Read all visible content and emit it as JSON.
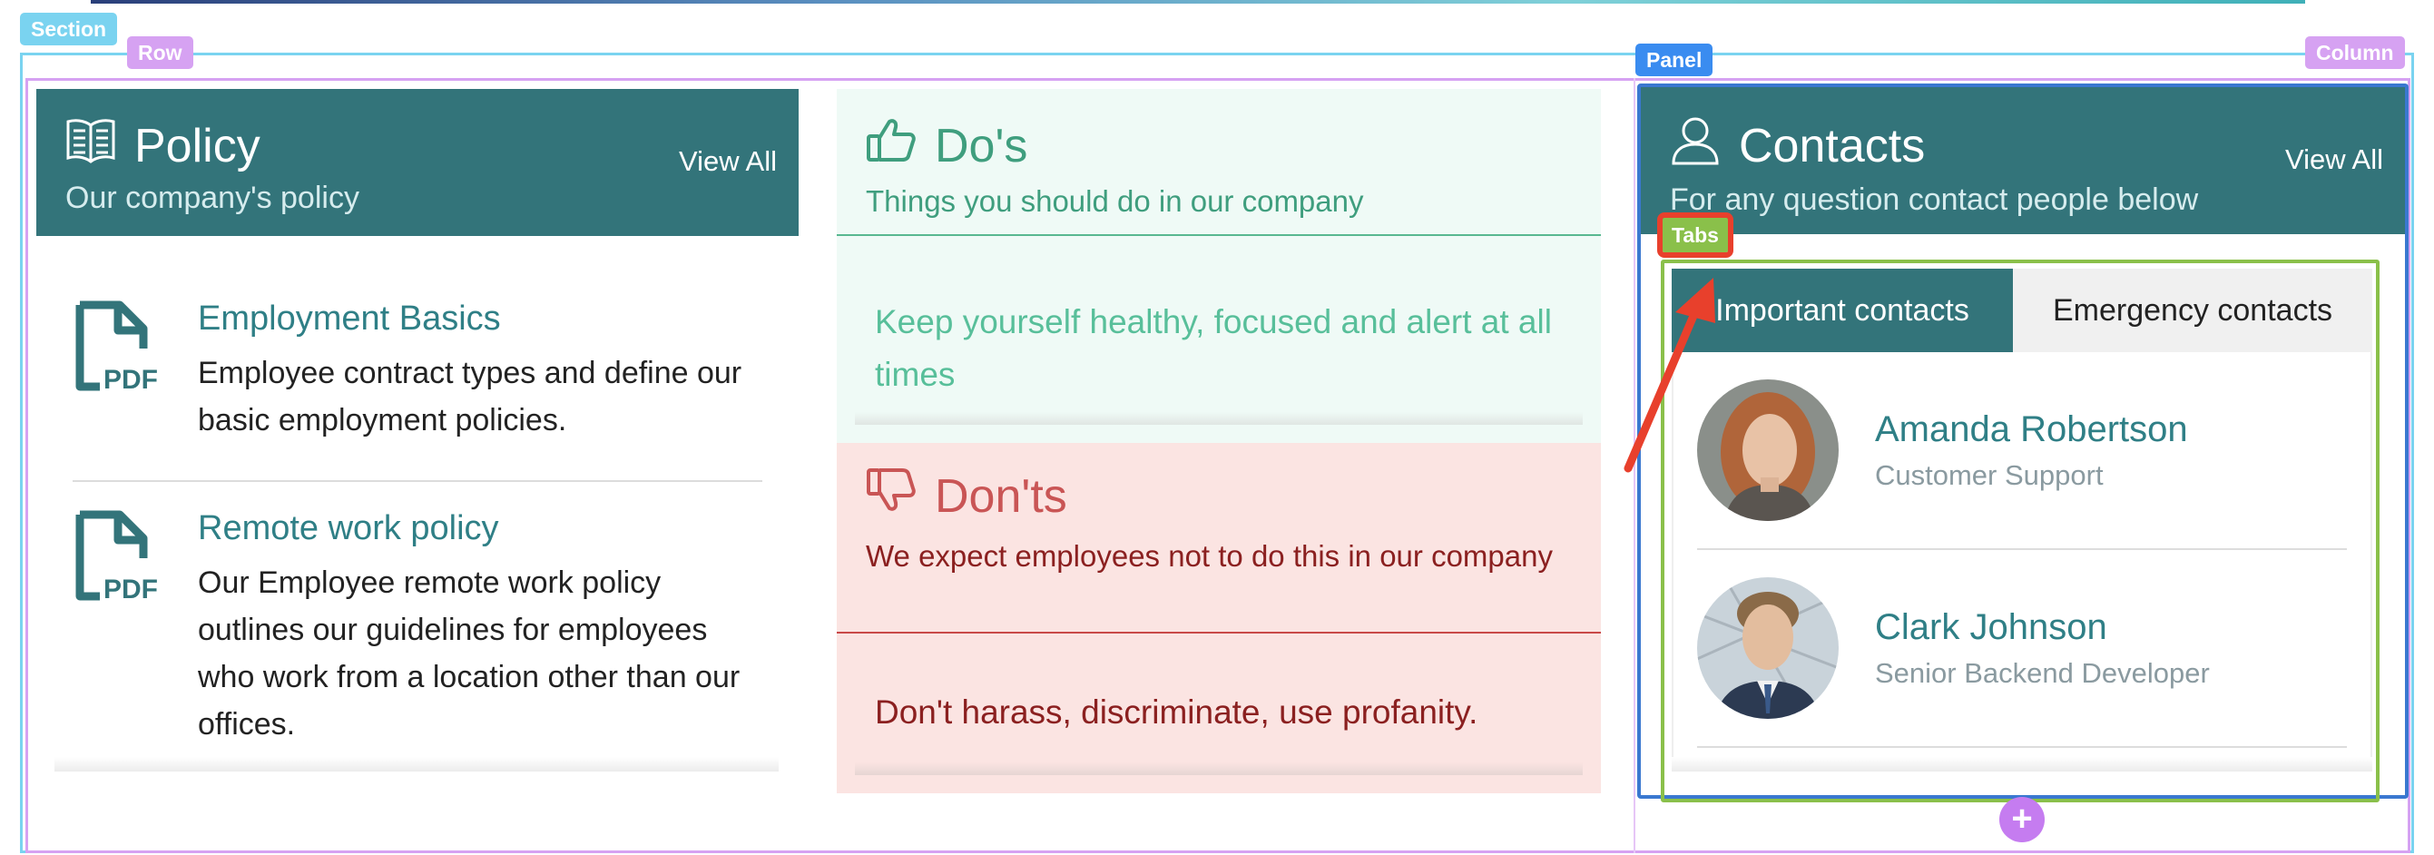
{
  "editor": {
    "section_tag": "Section",
    "row_tag": "Row",
    "panel_tag": "Panel",
    "column_tag": "Column",
    "tabs_tag": "Tabs",
    "add_icon": "+"
  },
  "policy": {
    "icon": "book-icon",
    "title": "Policy",
    "subtitle": "Our company's policy",
    "view_all": "View All",
    "items": [
      {
        "icon": "pdf-icon",
        "title": "Employment Basics",
        "description": "Employee contract types and define our basic employment policies."
      },
      {
        "icon": "pdf-icon",
        "title": "Remote work policy",
        "description": "Our Employee remote work policy outlines our guidelines for employees who work from a location other than our offices."
      }
    ]
  },
  "dos": {
    "icon": "thumbs-up-icon",
    "title": "Do's",
    "subtitle": "Things you should do in our company",
    "text": "Keep yourself healthy, focused and alert at all times"
  },
  "donts": {
    "icon": "thumbs-down-icon",
    "title": "Don'ts",
    "subtitle": "We expect employees not to do this in our company",
    "text": "Don't harass, discriminate, use profanity."
  },
  "contacts": {
    "icon": "user-icon",
    "title": "Contacts",
    "subtitle": "For any question contact people below",
    "view_all": "View All",
    "tabs": [
      {
        "label": "Important contacts",
        "active": true
      },
      {
        "label": "Emergency contacts",
        "active": false
      }
    ],
    "people": [
      {
        "name": "Amanda Robertson",
        "role": "Customer Support"
      },
      {
        "name": "Clark Johnson",
        "role": "Senior Backend Developer"
      }
    ]
  },
  "colors": {
    "teal_header": "#33747a",
    "dos_bg": "#effaf6",
    "donts_bg": "#fbe4e2",
    "section_outline": "#7ad3f0",
    "row_outline": "#d6a2f2",
    "panel_outline": "#3a78d0",
    "tabs_outline": "#8ac04a",
    "annotation_red": "#e8402c"
  }
}
